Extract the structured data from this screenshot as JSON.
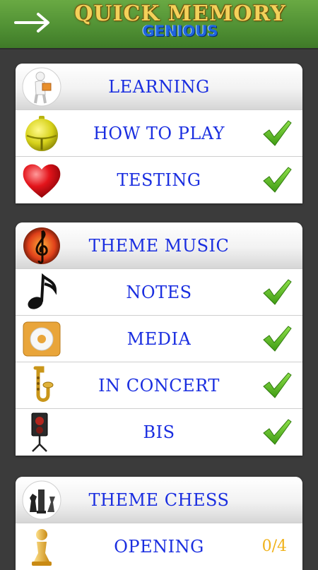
{
  "header": {
    "title": "QUICK MEMORY",
    "subtitle": "GENIOUS",
    "back_icon": "arrow-right-icon"
  },
  "sections": [
    {
      "title": "LEARNING",
      "items": [
        {
          "label": "HOW TO PLAY",
          "status": "done"
        },
        {
          "label": "TESTING",
          "status": "done"
        }
      ]
    },
    {
      "title": "THEME MUSIC",
      "items": [
        {
          "label": "NOTES",
          "status": "done"
        },
        {
          "label": "MEDIA",
          "status": "done"
        },
        {
          "label": "IN CONCERT",
          "status": "done"
        },
        {
          "label": "BIS",
          "status": "done"
        }
      ]
    },
    {
      "title": "THEME CHESS",
      "items": [
        {
          "label": "OPENING",
          "progress": "0/4"
        }
      ]
    }
  ],
  "colors": {
    "header_green": "#5a9b3a",
    "label_blue": "#1a2ee0",
    "check_green": "#4caf1e",
    "score_gold": "#f0b21a"
  }
}
